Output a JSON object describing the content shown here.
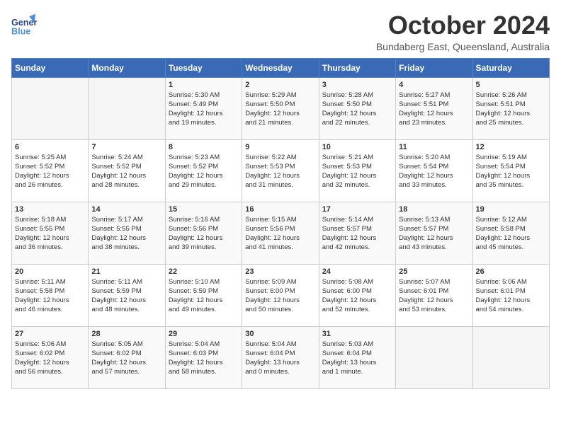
{
  "header": {
    "logo_text_general": "General",
    "logo_text_blue": "Blue",
    "month_title": "October 2024",
    "location": "Bundaberg East, Queensland, Australia"
  },
  "calendar": {
    "day_headers": [
      "Sunday",
      "Monday",
      "Tuesday",
      "Wednesday",
      "Thursday",
      "Friday",
      "Saturday"
    ],
    "weeks": [
      [
        {
          "day": "",
          "info": ""
        },
        {
          "day": "",
          "info": ""
        },
        {
          "day": "1",
          "info": "Sunrise: 5:30 AM\nSunset: 5:49 PM\nDaylight: 12 hours\nand 19 minutes."
        },
        {
          "day": "2",
          "info": "Sunrise: 5:29 AM\nSunset: 5:50 PM\nDaylight: 12 hours\nand 21 minutes."
        },
        {
          "day": "3",
          "info": "Sunrise: 5:28 AM\nSunset: 5:50 PM\nDaylight: 12 hours\nand 22 minutes."
        },
        {
          "day": "4",
          "info": "Sunrise: 5:27 AM\nSunset: 5:51 PM\nDaylight: 12 hours\nand 23 minutes."
        },
        {
          "day": "5",
          "info": "Sunrise: 5:26 AM\nSunset: 5:51 PM\nDaylight: 12 hours\nand 25 minutes."
        }
      ],
      [
        {
          "day": "6",
          "info": "Sunrise: 5:25 AM\nSunset: 5:52 PM\nDaylight: 12 hours\nand 26 minutes."
        },
        {
          "day": "7",
          "info": "Sunrise: 5:24 AM\nSunset: 5:52 PM\nDaylight: 12 hours\nand 28 minutes."
        },
        {
          "day": "8",
          "info": "Sunrise: 5:23 AM\nSunset: 5:52 PM\nDaylight: 12 hours\nand 29 minutes."
        },
        {
          "day": "9",
          "info": "Sunrise: 5:22 AM\nSunset: 5:53 PM\nDaylight: 12 hours\nand 31 minutes."
        },
        {
          "day": "10",
          "info": "Sunrise: 5:21 AM\nSunset: 5:53 PM\nDaylight: 12 hours\nand 32 minutes."
        },
        {
          "day": "11",
          "info": "Sunrise: 5:20 AM\nSunset: 5:54 PM\nDaylight: 12 hours\nand 33 minutes."
        },
        {
          "day": "12",
          "info": "Sunrise: 5:19 AM\nSunset: 5:54 PM\nDaylight: 12 hours\nand 35 minutes."
        }
      ],
      [
        {
          "day": "13",
          "info": "Sunrise: 5:18 AM\nSunset: 5:55 PM\nDaylight: 12 hours\nand 36 minutes."
        },
        {
          "day": "14",
          "info": "Sunrise: 5:17 AM\nSunset: 5:55 PM\nDaylight: 12 hours\nand 38 minutes."
        },
        {
          "day": "15",
          "info": "Sunrise: 5:16 AM\nSunset: 5:56 PM\nDaylight: 12 hours\nand 39 minutes."
        },
        {
          "day": "16",
          "info": "Sunrise: 5:15 AM\nSunset: 5:56 PM\nDaylight: 12 hours\nand 41 minutes."
        },
        {
          "day": "17",
          "info": "Sunrise: 5:14 AM\nSunset: 5:57 PM\nDaylight: 12 hours\nand 42 minutes."
        },
        {
          "day": "18",
          "info": "Sunrise: 5:13 AM\nSunset: 5:57 PM\nDaylight: 12 hours\nand 43 minutes."
        },
        {
          "day": "19",
          "info": "Sunrise: 5:12 AM\nSunset: 5:58 PM\nDaylight: 12 hours\nand 45 minutes."
        }
      ],
      [
        {
          "day": "20",
          "info": "Sunrise: 5:11 AM\nSunset: 5:58 PM\nDaylight: 12 hours\nand 46 minutes."
        },
        {
          "day": "21",
          "info": "Sunrise: 5:11 AM\nSunset: 5:59 PM\nDaylight: 12 hours\nand 48 minutes."
        },
        {
          "day": "22",
          "info": "Sunrise: 5:10 AM\nSunset: 5:59 PM\nDaylight: 12 hours\nand 49 minutes."
        },
        {
          "day": "23",
          "info": "Sunrise: 5:09 AM\nSunset: 6:00 PM\nDaylight: 12 hours\nand 50 minutes."
        },
        {
          "day": "24",
          "info": "Sunrise: 5:08 AM\nSunset: 6:00 PM\nDaylight: 12 hours\nand 52 minutes."
        },
        {
          "day": "25",
          "info": "Sunrise: 5:07 AM\nSunset: 6:01 PM\nDaylight: 12 hours\nand 53 minutes."
        },
        {
          "day": "26",
          "info": "Sunrise: 5:06 AM\nSunset: 6:01 PM\nDaylight: 12 hours\nand 54 minutes."
        }
      ],
      [
        {
          "day": "27",
          "info": "Sunrise: 5:06 AM\nSunset: 6:02 PM\nDaylight: 12 hours\nand 56 minutes."
        },
        {
          "day": "28",
          "info": "Sunrise: 5:05 AM\nSunset: 6:02 PM\nDaylight: 12 hours\nand 57 minutes."
        },
        {
          "day": "29",
          "info": "Sunrise: 5:04 AM\nSunset: 6:03 PM\nDaylight: 12 hours\nand 58 minutes."
        },
        {
          "day": "30",
          "info": "Sunrise: 5:04 AM\nSunset: 6:04 PM\nDaylight: 13 hours\nand 0 minutes."
        },
        {
          "day": "31",
          "info": "Sunrise: 5:03 AM\nSunset: 6:04 PM\nDaylight: 13 hours\nand 1 minute."
        },
        {
          "day": "",
          "info": ""
        },
        {
          "day": "",
          "info": ""
        }
      ]
    ]
  }
}
